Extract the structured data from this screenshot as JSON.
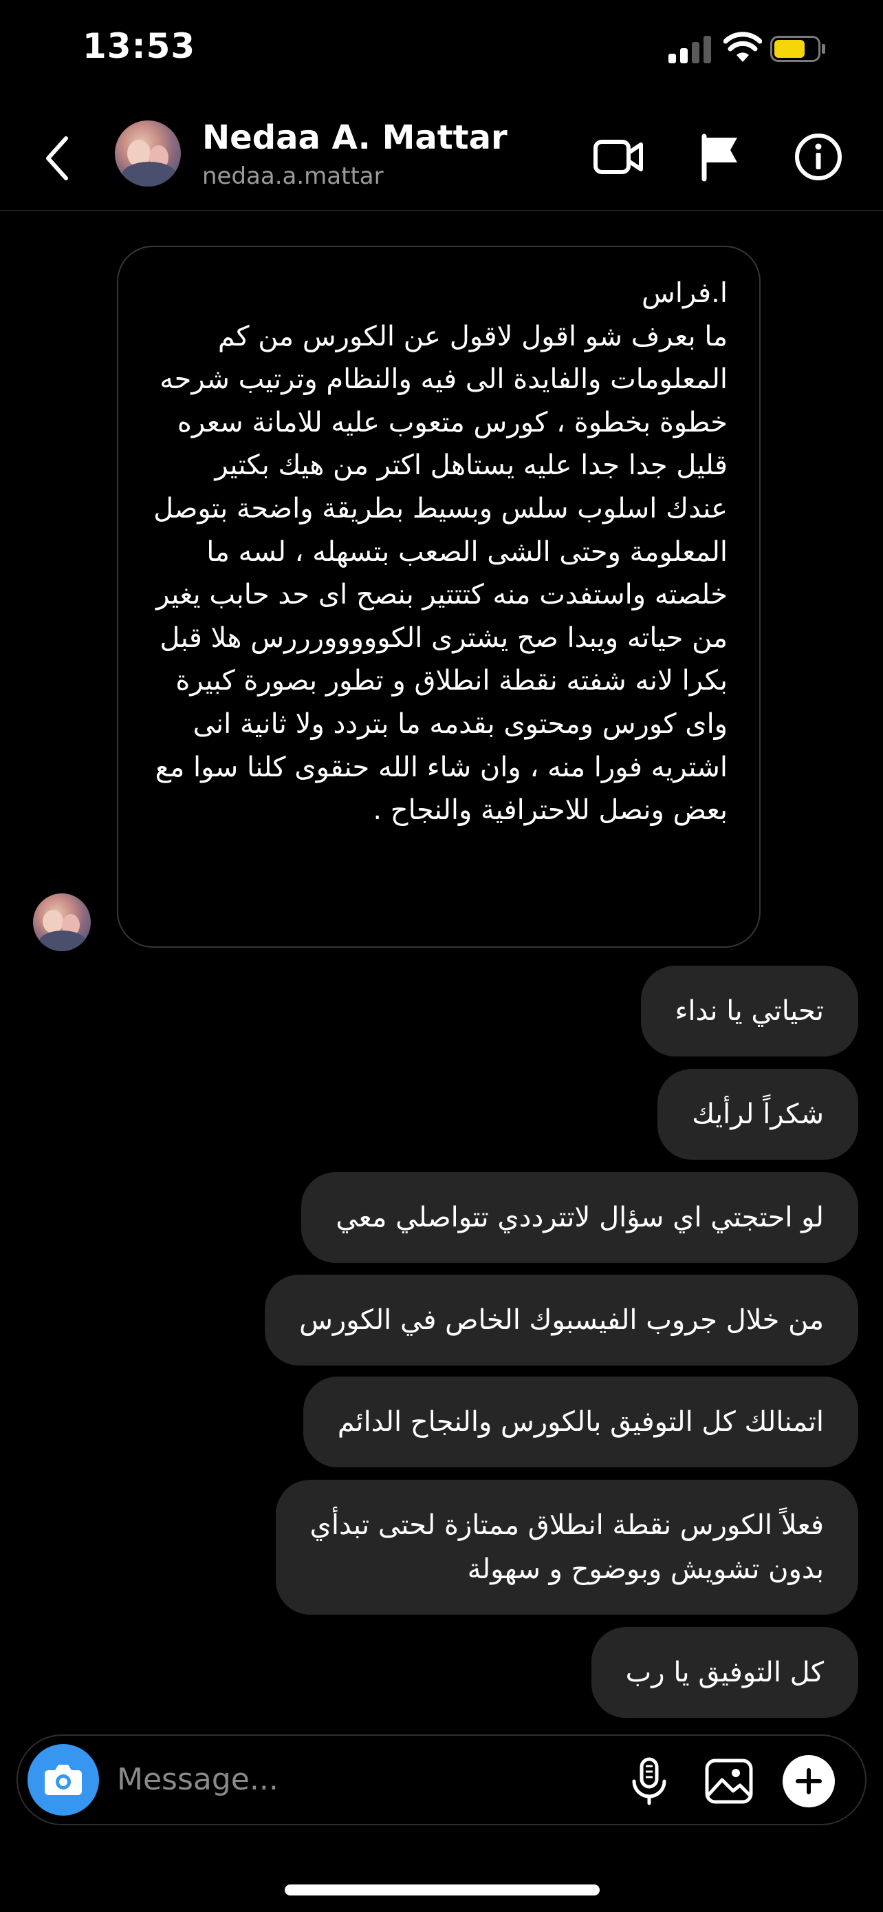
{
  "status_bar": {
    "time": "13:53"
  },
  "header": {
    "name": "Nedaa A. Mattar",
    "username": "nedaa.a.mattar"
  },
  "incoming_message": {
    "text": "ا.فراس\nما بعرف شو اقول لاقول عن الكورس من كم المعلومات والفايدة الى فيه والنظام وترتيب شرحه خطوة بخطوة ، كورس متعوب عليه للامانة سعره قليل جدا جدا عليه يستاهل اكتر من هيك بكتير\nعندك اسلوب سلس وبسيط بطريقة واضحة بتوصل المعلومة وحتى الشى الصعب بتسهله ، لسه ما خلصته واستفدت منه كتتتير بنصح اى حد حابب يغير من حياته ويبدا صح يشترى الكووووورررس هلا قبل بكرا لانه شفته نقطة انطلاق و تطور بصورة كبيرة واى كورس ومحتوى بقدمه ما بتردد ولا ثانية انى اشتريه فورا منه ، وان شاء الله حنقوى كلنا سوا مع بعض ونصل للاحترافية والنجاح ."
  },
  "outgoing_messages": [
    "تحياتي يا نداء",
    "شكراً لرأيك",
    "لو احتجتي اي سؤال لاتترددي تتواصلي معي",
    "من خلال جروب الفيسبوك الخاص في الكورس",
    "اتمنالك كل التوفيق بالكورس والنجاح الدائم",
    "فعلاً الكورس نقطة انطلاق ممتازة لحتى تبدأي\nبدون تشويش وبوضوح و سهولة",
    "كل التوفيق يا رب"
  ],
  "composer": {
    "placeholder": "Message..."
  },
  "icons": {
    "back": "chevron-left-icon",
    "video": "video-camera-icon",
    "flag": "flag-icon",
    "info": "info-icon",
    "camera": "camera-icon",
    "mic": "microphone-icon",
    "gallery": "image-icon",
    "add": "plus-icon"
  },
  "colors": {
    "background": "#000000",
    "bubble_outgoing": "#262626",
    "bubble_incoming_border": "#363636",
    "camera_button": "#3797f0",
    "battery": "#f5d60a"
  }
}
